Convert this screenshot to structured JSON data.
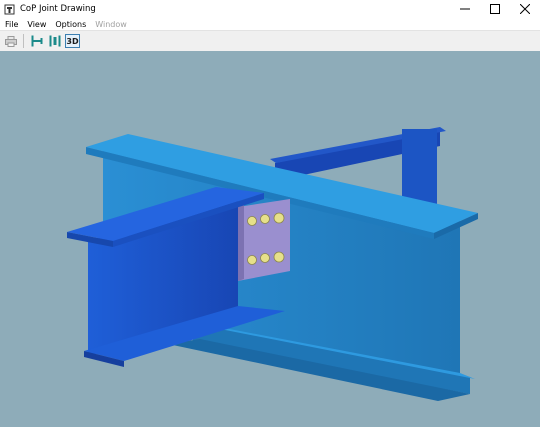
{
  "window": {
    "title": "CoP Joint Drawing",
    "controls": [
      "minimize-icon",
      "maximize-icon",
      "close-icon"
    ]
  },
  "menu": {
    "items": [
      {
        "label": "File",
        "enabled": true
      },
      {
        "label": "View",
        "enabled": true
      },
      {
        "label": "Options",
        "enabled": true
      },
      {
        "label": "Window",
        "enabled": false
      }
    ]
  },
  "toolbar": {
    "buttons": [
      {
        "icon": "print-icon",
        "enabled": false
      },
      {
        "icon": "elevation-view-icon",
        "enabled": true
      },
      {
        "icon": "section-view-icon",
        "enabled": true
      },
      {
        "icon": "3d-view-icon",
        "label": "3D",
        "enabled": true,
        "active": true
      }
    ]
  },
  "viewport": {
    "background": "#8eacb9",
    "scene": "3D steel beam-to-column joint with fin plate and bolts",
    "colors": {
      "main_beam": "#2a8fd4",
      "main_beam_shade": "#1f76b6",
      "secondary_beam": "#1f5fd8",
      "secondary_beam_shade": "#1846b4",
      "fin_plate": "#9a8fcf",
      "bolt": "#e6e08a"
    }
  }
}
